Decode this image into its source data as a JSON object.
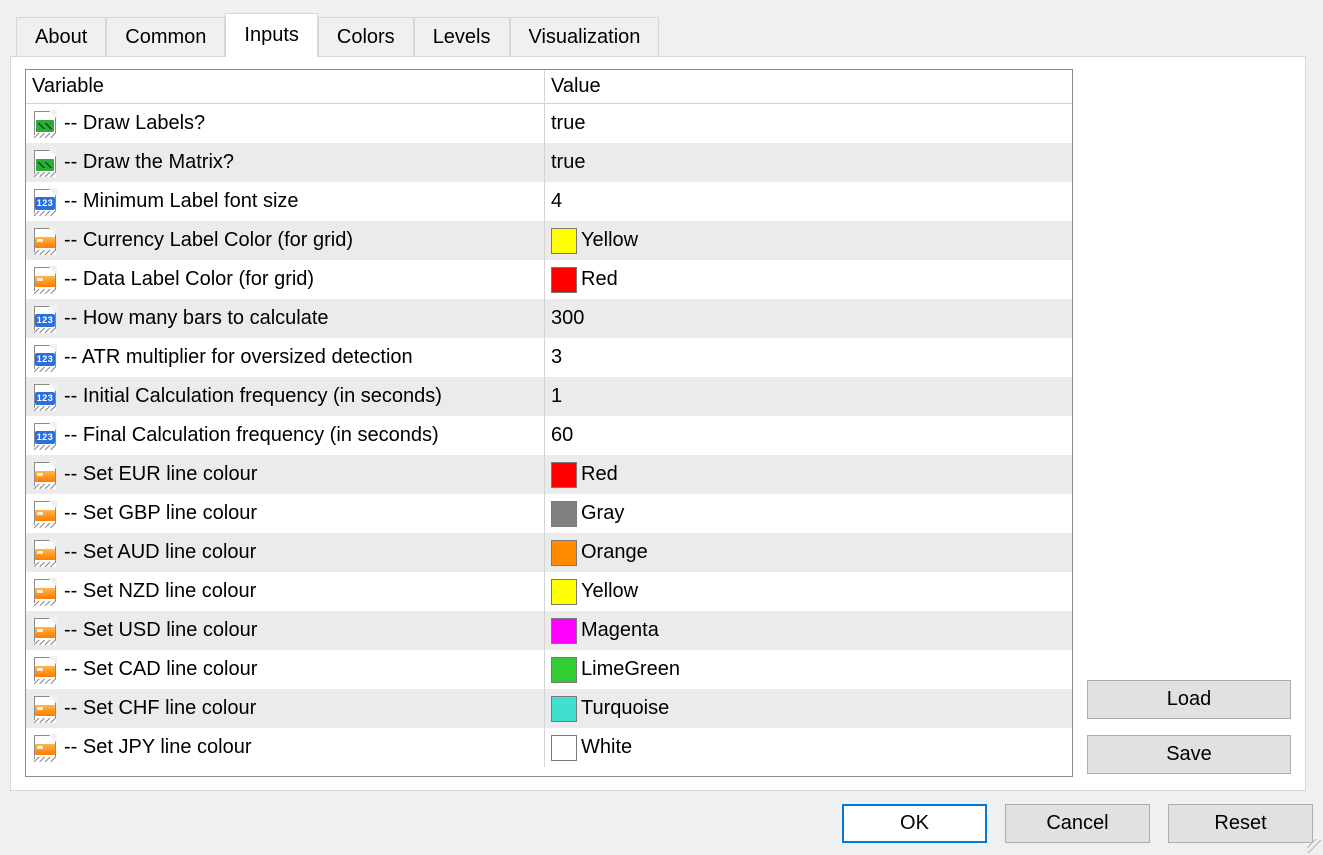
{
  "tabs": {
    "about": "About",
    "common": "Common",
    "inputs": "Inputs",
    "colors": "Colors",
    "levels": "Levels",
    "visualization": "Visualization"
  },
  "grid": {
    "header_variable": "Variable",
    "header_value": "Value",
    "rows": [
      {
        "type": "bool",
        "label": "-- Draw Labels?",
        "value": "true"
      },
      {
        "type": "bool",
        "label": "-- Draw the Matrix?",
        "value": "true"
      },
      {
        "type": "int",
        "label": "-- Minimum Label font size",
        "value": "4"
      },
      {
        "type": "color",
        "label": "-- Currency Label Color (for grid)",
        "value": "Yellow",
        "swatch": "#ffff00"
      },
      {
        "type": "color",
        "label": "-- Data Label Color (for grid)",
        "value": "Red",
        "swatch": "#ff0000"
      },
      {
        "type": "int",
        "label": "-- How many bars to calculate",
        "value": "300"
      },
      {
        "type": "int",
        "label": "-- ATR multiplier for oversized detection",
        "value": "3"
      },
      {
        "type": "int",
        "label": "-- Initial Calculation frequency (in seconds)",
        "value": "1"
      },
      {
        "type": "int",
        "label": "-- Final Calculation frequency (in seconds)",
        "value": "60"
      },
      {
        "type": "color",
        "label": "-- Set EUR line colour",
        "value": "Red",
        "swatch": "#ff0000"
      },
      {
        "type": "color",
        "label": "-- Set GBP line colour",
        "value": "Gray",
        "swatch": "#808080"
      },
      {
        "type": "color",
        "label": "-- Set AUD line colour",
        "value": "Orange",
        "swatch": "#ff8c00"
      },
      {
        "type": "color",
        "label": "-- Set NZD line colour",
        "value": "Yellow",
        "swatch": "#ffff00"
      },
      {
        "type": "color",
        "label": "-- Set USD line colour",
        "value": "Magenta",
        "swatch": "#ff00ff"
      },
      {
        "type": "color",
        "label": "-- Set CAD line colour",
        "value": "LimeGreen",
        "swatch": "#32cd32"
      },
      {
        "type": "color",
        "label": "-- Set CHF line colour",
        "value": "Turquoise",
        "swatch": "#40e0d0"
      },
      {
        "type": "color",
        "label": "-- Set JPY line colour",
        "value": "White",
        "swatch": "#ffffff"
      }
    ]
  },
  "buttons": {
    "load": "Load",
    "save": "Save",
    "ok": "OK",
    "cancel": "Cancel",
    "reset": "Reset"
  },
  "int_glyph_text": "123"
}
